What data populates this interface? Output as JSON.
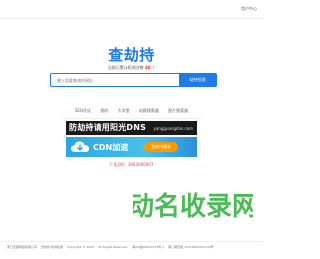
{
  "topbar": {
    "user_center": "用户中心"
  },
  "logo": {
    "text": "查劫持"
  },
  "subtitle": {
    "prefix": "当前已累计检测次数",
    "count": "48",
    "arrow": "↑"
  },
  "search": {
    "placeholder": "输入您要查询的网址",
    "button": "劫持检测"
  },
  "nav": {
    "items": [
      "SEO优化",
      "我的",
      "大学堂",
      "站群搜索器",
      "图片搜索器"
    ]
  },
  "banners": {
    "banner1": {
      "title": "防劫持请用阳光DNS",
      "domain": "yangguangdns.com"
    },
    "banner2": {
      "title": "CDN加速",
      "button": "查劫持服务"
    }
  },
  "ad_contact": "广告QQ：3063006007",
  "footer": {
    "items": [
      "厦门天籁网络有限公司",
      "查劫持 劫持检测",
      "Copyright © 2025",
      "All Rights Reserved.",
      "闽ICP备09011272号-1",
      "闽公网安备 35020502001330号"
    ]
  },
  "watermark": {
    "text": "动名收录网"
  },
  "colors": {
    "brand": "#1e7be8",
    "accent_red": "#e53935",
    "orange": "#ff9800"
  }
}
